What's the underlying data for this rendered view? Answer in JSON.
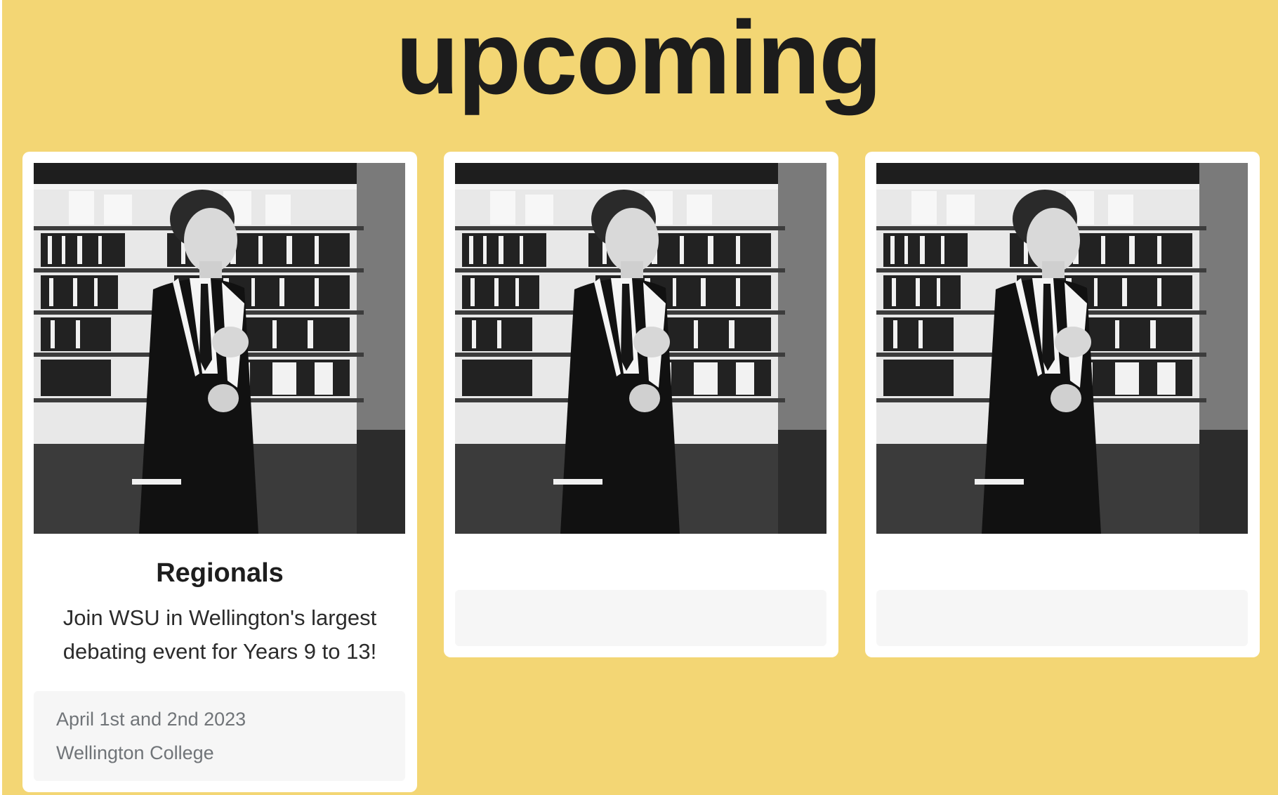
{
  "page": {
    "title": "upcoming",
    "background_color": "#f3d674"
  },
  "events": [
    {
      "image": "photo-student-speaking-in-library",
      "title": "Regionals",
      "description": "Join WSU in Wellington's largest debating event for Years 9 to 13!",
      "date": "April 1st and 2nd 2023",
      "venue": "Wellington College"
    },
    {
      "image": "photo-student-speaking-in-library",
      "title": "",
      "description": "",
      "date": "",
      "venue": ""
    },
    {
      "image": "photo-student-speaking-in-library",
      "title": "",
      "description": "",
      "date": "",
      "venue": ""
    }
  ]
}
